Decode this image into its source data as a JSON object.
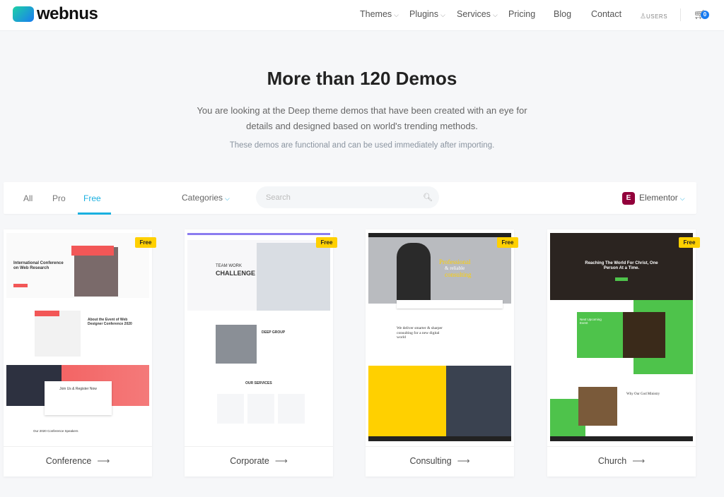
{
  "header": {
    "logo": "webnus",
    "nav": [
      {
        "label": "Themes",
        "dropdown": true
      },
      {
        "label": "Plugins",
        "dropdown": true
      },
      {
        "label": "Services",
        "dropdown": true
      },
      {
        "label": "Pricing"
      },
      {
        "label": "Blog"
      },
      {
        "label": "Contact"
      }
    ],
    "users_label": "USERS",
    "cart_count": "0"
  },
  "hero": {
    "title": "More than 120 Demos",
    "subtitle": "You are looking at the Deep theme demos that have been created with an eye for details and designed based on world's trending methods.",
    "note": "These demos are functional and can be used immediately after importing."
  },
  "filter": {
    "tabs": [
      "All",
      "Pro",
      "Free"
    ],
    "active_tab": "Free",
    "categories_label": "Categories",
    "search_placeholder": "Search",
    "builder_label": "Elementor"
  },
  "colors": {
    "accent": "#1ab0e0",
    "badge": "#ffd000",
    "elementor": "#92003b"
  },
  "demos": [
    {
      "name": "Conference",
      "badge": "Free",
      "thumb": {
        "heading": "International Conference on Web Research",
        "cta": "Join Us & Register Now",
        "section": "About the Event of Web Designer Conference 2020",
        "speakers": "Our 2020 Conference Speakers"
      }
    },
    {
      "name": "Corporate",
      "badge": "Free",
      "thumb": {
        "heading1": "TEAM WORK",
        "heading2": "CHALLENGE",
        "section": "DEEP GROUP",
        "services": "OUR SERVICES"
      }
    },
    {
      "name": "Consulting",
      "badge": "Free",
      "thumb": {
        "heading1": "Professional",
        "heading2": "& reliable",
        "heading3": "consulting",
        "section": "We deliver smarter & sharper consulting for a new digital world"
      }
    },
    {
      "name": "Church",
      "badge": "Free",
      "thumb": {
        "heading": "Reaching The World For Christ, One Person At a Time.",
        "event": "Next Upcoming Event",
        "section": "Why Our God Ministry"
      }
    }
  ]
}
